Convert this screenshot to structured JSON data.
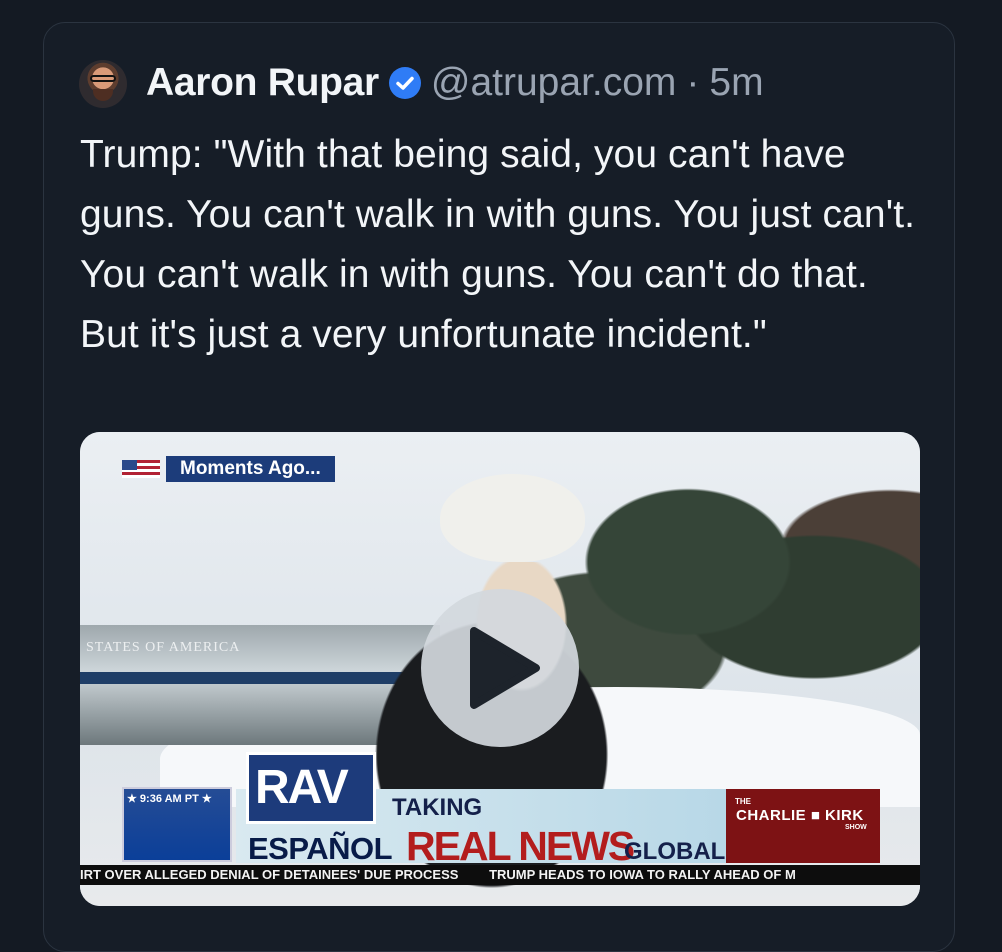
{
  "post": {
    "author_name": "Aaron Rupar",
    "handle": "@atrupar.com",
    "separator": "·",
    "time": "5m",
    "text": "Trump: \"With that being said, you can't have guns. You can't walk in with guns. You just can't. You can't walk in with guns. You can't do that. But it's just a very unfortunate incident.\""
  },
  "video": {
    "moments_label": "Moments Ago...",
    "plane_text": "STATES OF AMERICA",
    "clock": "★ 9:36 AM PT ★",
    "logo": "RAV",
    "espanol": "ESPAÑOL",
    "taking": "TAKING",
    "real_news": "REAL NEWS",
    "global": "GLOBAL",
    "ck_the": "THE",
    "ck_name": "CHARLIE ■ KIRK",
    "ck_show": "SHOW",
    "ticker_1": "IRT OVER ALLEGED DENIAL OF DETAINEES' DUE PROCESS",
    "ticker_2": "TRUMP HEADS TO IOWA TO RALLY AHEAD OF M"
  },
  "icons": {
    "avatar": "profile-avatar",
    "verified": "verified-badge",
    "play": "play-icon"
  }
}
